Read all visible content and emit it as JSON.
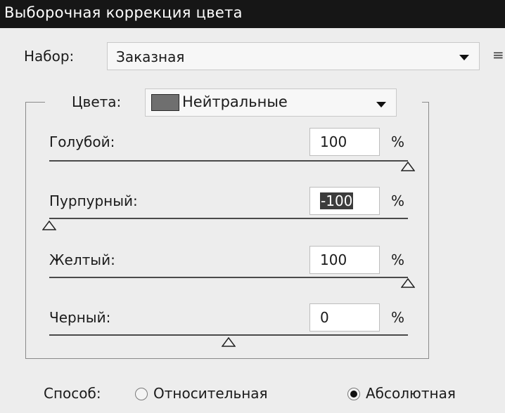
{
  "title": "Выборочная коррекция цвета",
  "preset": {
    "label": "Набор:",
    "value": "Заказная"
  },
  "colors": {
    "label": "Цвета:",
    "value": "Нейтральные",
    "swatch": "#6f6f6f"
  },
  "sliders": [
    {
      "label": "Голубой:",
      "value": "100",
      "unit": "%",
      "level": 1.0
    },
    {
      "label": "Пурпурный:",
      "value": "-100",
      "unit": "%",
      "level": 0.0,
      "selected": true
    },
    {
      "label": "Желтый:",
      "value": "100",
      "unit": "%",
      "level": 1.0
    },
    {
      "label": "Черный:",
      "value": "0",
      "unit": "%",
      "level": 0.5
    }
  ],
  "method": {
    "label": "Способ:",
    "options": [
      {
        "label": "Относительная",
        "checked": false
      },
      {
        "label": "Абсолютная",
        "checked": true
      }
    ]
  },
  "icons": {
    "options": "options-icon",
    "dropdown": "chevron-down-icon",
    "thumb": "slider-thumb-icon"
  },
  "colors_palette": {
    "titlebar": "#161616",
    "panel": "#ededed"
  }
}
